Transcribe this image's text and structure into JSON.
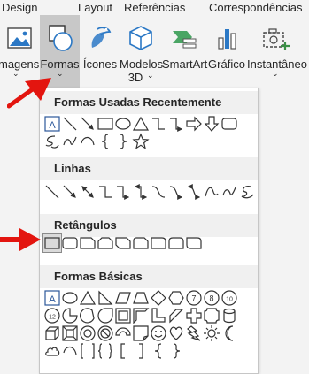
{
  "ribbon_tabs": [
    "Design",
    "Layout",
    "Referências",
    "Correspondências"
  ],
  "ribbon_buttons": [
    {
      "id": "images",
      "label": "magens",
      "label2": "",
      "icon": "image-icon",
      "has_chevron": true
    },
    {
      "id": "shapes",
      "label": "Formas",
      "label2": "",
      "icon": "shapes-icon",
      "has_chevron": true,
      "active": true
    },
    {
      "id": "icons",
      "label": "Ícones",
      "label2": "",
      "icon": "icons-icon",
      "has_chevron": false
    },
    {
      "id": "models3d",
      "label": "Modelos",
      "label2": "3D",
      "icon": "cube-icon",
      "has_chevron": true
    },
    {
      "id": "smartart",
      "label": "SmartArt",
      "label2": "",
      "icon": "smartart-icon",
      "has_chevron": false
    },
    {
      "id": "chart",
      "label": "Gráfico",
      "label2": "",
      "icon": "chart-icon",
      "has_chevron": false
    },
    {
      "id": "screenshot",
      "label": "Instantâneo",
      "label2": "",
      "icon": "camera-plus-icon",
      "has_chevron": true
    }
  ],
  "gallery": {
    "sections": [
      {
        "title": "Formas Usadas Recentemente",
        "shapes": [
          "text-box",
          "line",
          "line-arrow",
          "rectangle",
          "oval",
          "triangle",
          "elbow-connector",
          "elbow-arrow-connector",
          "right-arrow",
          "down-arrow",
          "rounded-rectangle",
          "freeform-scribble",
          "freeform",
          "arc",
          "left-brace",
          "right-brace",
          "star"
        ]
      },
      {
        "title": "Linhas",
        "shapes": [
          "line",
          "line-arrow",
          "line-double-arrow",
          "elbow-connector",
          "elbow-arrow-connector",
          "elbow-double-arrow-connector",
          "curved-connector",
          "curved-arrow-connector",
          "curved-double-arrow-connector",
          "curve",
          "freeform",
          "scribble"
        ]
      },
      {
        "title": "Retângulos",
        "shapes": [
          "rectangle",
          "rounded-rectangle",
          "snip-single-corner-rectangle",
          "snip-same-side-corner-rectangle",
          "snip-diagonal-corner-rectangle",
          "snip-and-round-single-corner-rectangle",
          "round-single-corner-rectangle",
          "round-same-side-corner-rectangle",
          "round-diagonal-corner-rectangle"
        ]
      },
      {
        "title": "Formas Básicas",
        "shapes": [
          "text-box",
          "oval",
          "triangle",
          "right-triangle",
          "parallelogram",
          "trapezoid",
          "diamond",
          "hexagon",
          "heptagon",
          "octagon",
          "decagon",
          "dodecagon",
          "pie",
          "chord",
          "teardrop",
          "frame",
          "half-frame",
          "l-shape",
          "diagonal-stripe",
          "cross",
          "plaque",
          "can",
          "cube",
          "bevel",
          "donut",
          "no-symbol",
          "block-arc",
          "folded-corner",
          "smiley-face",
          "heart",
          "lightning-bolt",
          "sun",
          "moon",
          "cloud",
          "arc",
          "double-bracket",
          "double-brace",
          "left-bracket",
          "right-bracket",
          "left-brace",
          "right-brace"
        ]
      }
    ],
    "number_labels": {
      "heptagon": "7",
      "octagon": "8",
      "decagon": "10",
      "dodecagon": "12"
    },
    "text_box_glyph": "A"
  },
  "colors": {
    "accent": "#2b579a",
    "arrow": "#e3150f",
    "selected_bg": "#dadada"
  }
}
